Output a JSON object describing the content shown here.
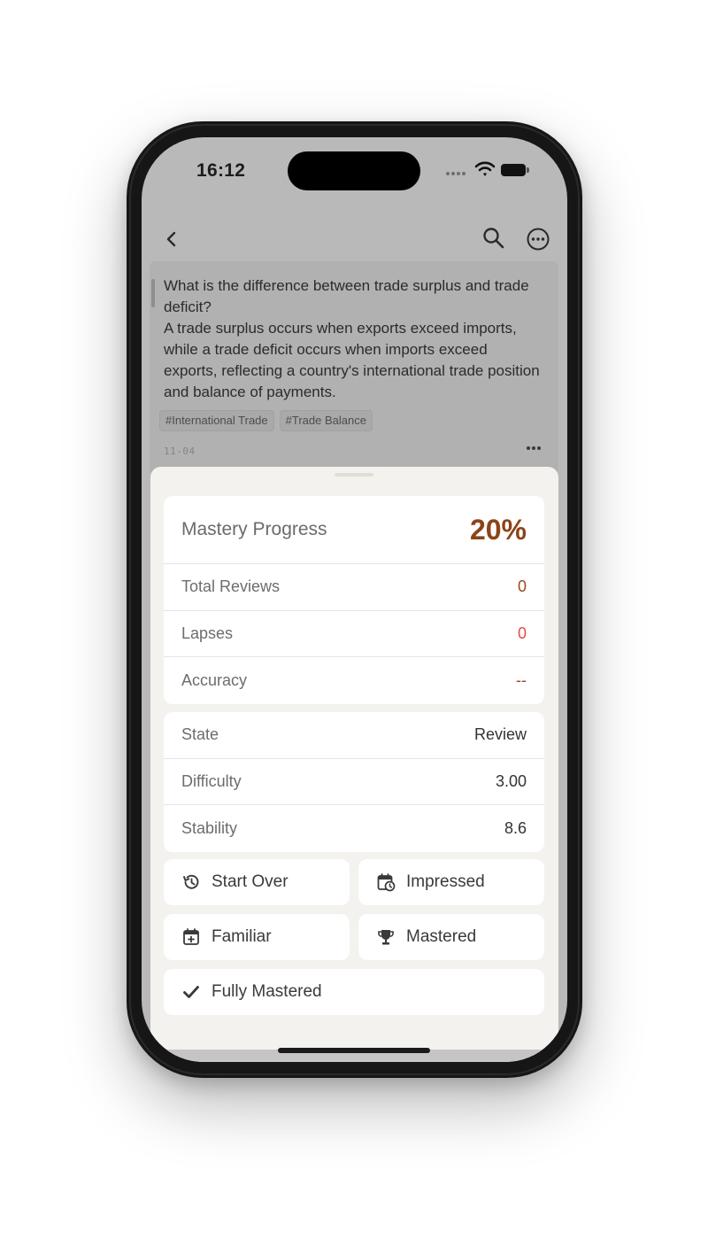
{
  "status_bar": {
    "time": "16:12"
  },
  "note": {
    "question": "What is the difference between trade surplus and trade deficit?",
    "answer": "A trade surplus occurs when exports exceed imports, while a trade deficit occurs when imports exceed exports, reflecting a country's international trade position and balance of payments.",
    "tags": [
      "#International Trade",
      "#Trade Balance"
    ],
    "date": "11-04"
  },
  "stats": {
    "mastery_label": "Mastery Progress",
    "mastery_value": "20%",
    "total_reviews_label": "Total Reviews",
    "total_reviews_value": "0",
    "lapses_label": "Lapses",
    "lapses_value": "0",
    "accuracy_label": "Accuracy",
    "accuracy_value": "--"
  },
  "state": {
    "state_label": "State",
    "state_value": "Review",
    "difficulty_label": "Difficulty",
    "difficulty_value": "3.00",
    "stability_label": "Stability",
    "stability_value": "8.6"
  },
  "actions": {
    "start_over": "Start Over",
    "impressed": "Impressed",
    "familiar": "Familiar",
    "mastered": "Mastered",
    "fully_mastered": "Fully Mastered"
  },
  "colors": {
    "accent_brown": "#8b4417",
    "lapses_red": "#e84a4a",
    "sheet_bg": "#f4f2ee",
    "dim_overlay": "#b9b9b9"
  },
  "icons": {
    "back": "chevron-left-icon",
    "search": "search-icon",
    "more": "more-circle-icon",
    "start_over": "history-icon",
    "impressed": "calendar-clock-icon",
    "familiar": "calendar-plus-icon",
    "mastered": "trophy-icon",
    "fully_mastered": "checkmark-icon"
  }
}
